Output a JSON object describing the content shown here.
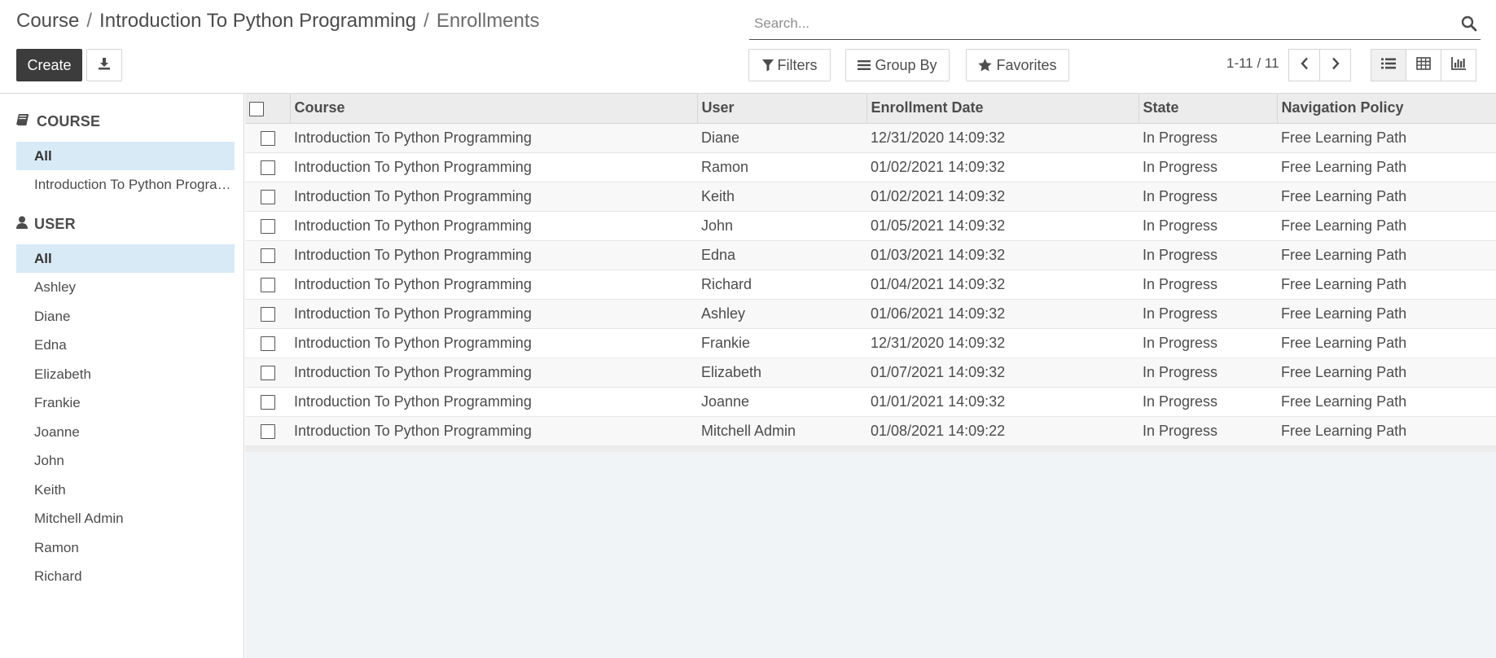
{
  "breadcrumb": {
    "items": [
      "Course",
      "Introduction To Python Programming"
    ],
    "separator": "/",
    "current": "Enrollments"
  },
  "search": {
    "placeholder": "Search...",
    "value": ""
  },
  "toolbar": {
    "create_label": "Create",
    "download_icon": "download-icon",
    "filters_label": "Filters",
    "groupby_label": "Group By",
    "favorites_label": "Favorites"
  },
  "pager": {
    "value": "1-11 / 11"
  },
  "views": [
    "list-view-icon",
    "pivot-view-icon",
    "graph-view-icon"
  ],
  "sidebar": {
    "course": {
      "title": "COURSE",
      "icon": "book-icon",
      "items": [
        "All",
        "Introduction To Python Programming"
      ]
    },
    "user": {
      "title": "USER",
      "icon": "user-icon",
      "items": [
        "All",
        "Ashley",
        "Diane",
        "Edna",
        "Elizabeth",
        "Frankie",
        "Joanne",
        "John",
        "Keith",
        "Mitchell Admin",
        "Ramon",
        "Richard"
      ]
    }
  },
  "table": {
    "columns": [
      "Course",
      "User",
      "Enrollment Date",
      "State",
      "Navigation Policy"
    ],
    "rows": [
      [
        "Introduction To Python Programming",
        "Diane",
        "12/31/2020 14:09:32",
        "In Progress",
        "Free Learning Path"
      ],
      [
        "Introduction To Python Programming",
        "Ramon",
        "01/02/2021 14:09:32",
        "In Progress",
        "Free Learning Path"
      ],
      [
        "Introduction To Python Programming",
        "Keith",
        "01/02/2021 14:09:32",
        "In Progress",
        "Free Learning Path"
      ],
      [
        "Introduction To Python Programming",
        "John",
        "01/05/2021 14:09:32",
        "In Progress",
        "Free Learning Path"
      ],
      [
        "Introduction To Python Programming",
        "Edna",
        "01/03/2021 14:09:32",
        "In Progress",
        "Free Learning Path"
      ],
      [
        "Introduction To Python Programming",
        "Richard",
        "01/04/2021 14:09:32",
        "In Progress",
        "Free Learning Path"
      ],
      [
        "Introduction To Python Programming",
        "Ashley",
        "01/06/2021 14:09:32",
        "In Progress",
        "Free Learning Path"
      ],
      [
        "Introduction To Python Programming",
        "Frankie",
        "12/31/2020 14:09:32",
        "In Progress",
        "Free Learning Path"
      ],
      [
        "Introduction To Python Programming",
        "Elizabeth",
        "01/07/2021 14:09:32",
        "In Progress",
        "Free Learning Path"
      ],
      [
        "Introduction To Python Programming",
        "Joanne",
        "01/01/2021 14:09:32",
        "In Progress",
        "Free Learning Path"
      ],
      [
        "Introduction To Python Programming",
        "Mitchell Admin",
        "01/08/2021 14:09:22",
        "In Progress",
        "Free Learning Path"
      ]
    ]
  },
  "colors": {
    "primary_button": "#3c3c3c",
    "active_filter": "#d8eaf6",
    "list_background": "#f1f4f7"
  }
}
